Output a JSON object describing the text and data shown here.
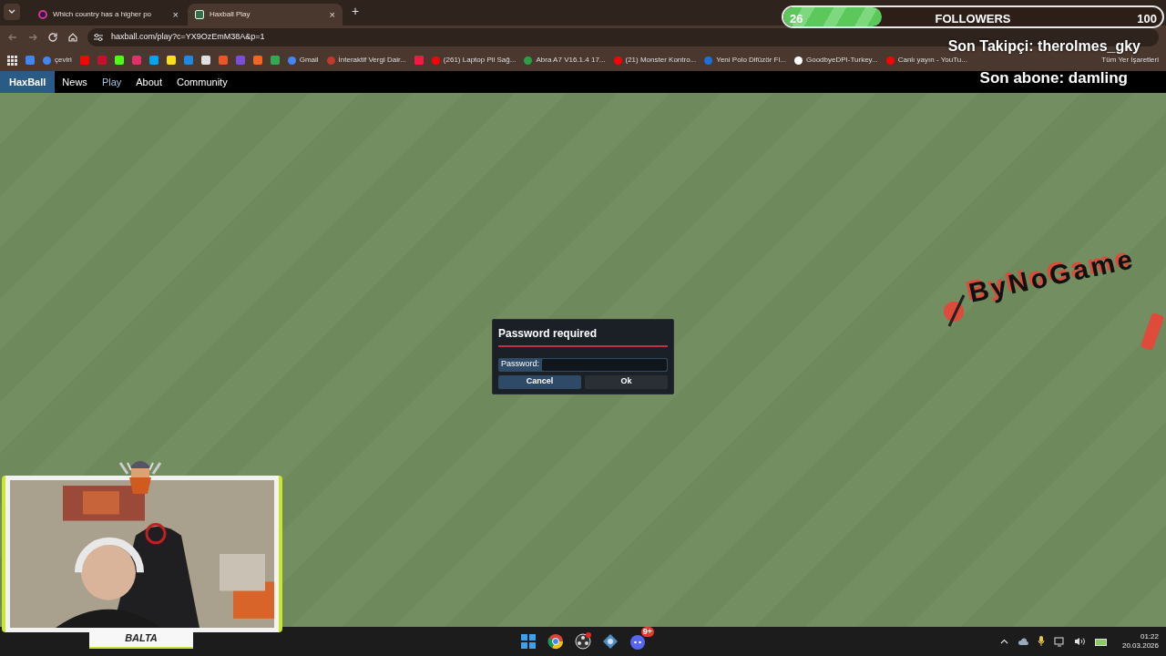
{
  "browser": {
    "tabs": [
      {
        "title": "Which country has a higher po",
        "selected": false,
        "close": "×"
      },
      {
        "title": "Haxball Play",
        "selected": true,
        "close": "×"
      }
    ],
    "new_tab": "+",
    "url": "haxball.com/play?c=YX9OzEmM38A&p=1",
    "bookmarks": [
      {
        "kind": "icon",
        "color": "#4285f4"
      },
      {
        "kind": "link",
        "label": "çeviri",
        "color": "#4285f4"
      },
      {
        "kind": "icon",
        "color": "#ff0000"
      },
      {
        "kind": "icon",
        "color": "#c8102e"
      },
      {
        "kind": "icon",
        "color": "#53fc18"
      },
      {
        "kind": "icon",
        "color": "#e1306c"
      },
      {
        "kind": "icon",
        "color": "#00a4ef"
      },
      {
        "kind": "icon",
        "color": "#f7e018"
      },
      {
        "kind": "icon",
        "color": "#1e88e5"
      },
      {
        "kind": "icon",
        "color": "#e0e0e0"
      },
      {
        "kind": "icon",
        "color": "#e8562a"
      },
      {
        "kind": "icon",
        "color": "#7b4fd6"
      },
      {
        "kind": "icon",
        "color": "#f26522"
      },
      {
        "kind": "icon",
        "color": "#34a853"
      },
      {
        "kind": "link",
        "label": "Gmail",
        "color": "#4285f4"
      },
      {
        "kind": "link",
        "label": "İnteraktif Vergi Dair...",
        "color": "#c0392b"
      },
      {
        "kind": "icon",
        "color": "#ff1744"
      },
      {
        "kind": "link",
        "label": "(261) Laptop Pil Sağ...",
        "color": "#ff0000"
      },
      {
        "kind": "link",
        "label": "Abra A7 V16.1.4 17...",
        "color": "#2e9e44"
      },
      {
        "kind": "link",
        "label": "(21) Monster Kontro...",
        "color": "#ff0000"
      },
      {
        "kind": "link",
        "label": "Yeni Polo Difüzör Fl...",
        "color": "#1e6fd9"
      },
      {
        "kind": "link",
        "label": "GoodbyeDPI-Turkey...",
        "color": "#ffffff"
      },
      {
        "kind": "link",
        "label": "Canlı yayın - YouTu...",
        "color": "#ff0000"
      }
    ],
    "all_bookmarks": "Tüm Yer İşaretleri"
  },
  "site_nav": {
    "brand": "HaxBall",
    "links": [
      {
        "label": "News",
        "selected": false
      },
      {
        "label": "Play",
        "selected": true
      },
      {
        "label": "About",
        "selected": false
      },
      {
        "label": "Community",
        "selected": false
      }
    ]
  },
  "dialog": {
    "title": "Password required",
    "field_label": "Password:",
    "buttons": [
      {
        "label": "Cancel",
        "kind": "primary"
      },
      {
        "label": "Ok",
        "kind": "secondary"
      }
    ]
  },
  "stream_overlay": {
    "follower_goal": {
      "current": "26",
      "label": "FOLLOWERS",
      "target": "100",
      "level": 0.26
    },
    "last_follower": "Son Takipçi: therolmes_gky",
    "last_subscriber": "Son abone: damling",
    "logo": "ByNoGame",
    "webcam_name": "BALTA"
  },
  "taskbar": {
    "apps": [
      {
        "kind": "start"
      },
      {
        "kind": "browser"
      },
      {
        "kind": "recorder"
      },
      {
        "kind": "game"
      },
      {
        "kind": "chat",
        "badge": "9+"
      }
    ],
    "time": "01:22",
    "date": "20.03.2026"
  }
}
